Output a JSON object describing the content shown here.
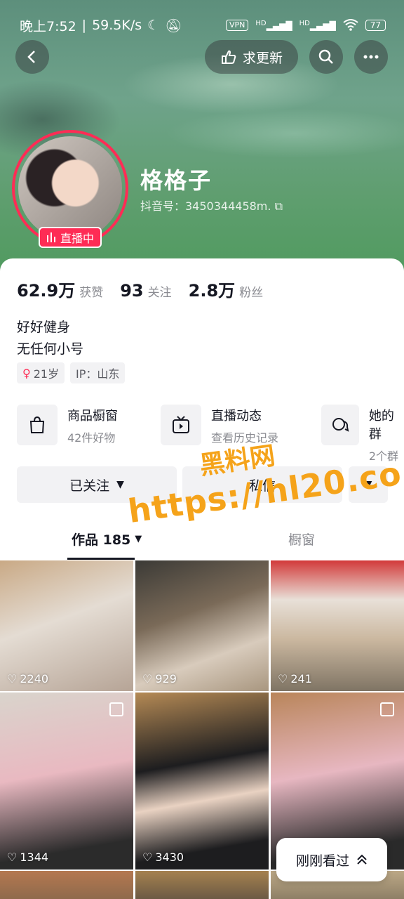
{
  "status_bar": {
    "time": "晚上7:52",
    "speed": "59.5K/s",
    "vpn": "VPN",
    "hd1": "HD",
    "hd2": "HD",
    "battery": "77"
  },
  "header": {
    "request_update": "求更新"
  },
  "profile": {
    "name": "格格子",
    "douyin_id": "抖音号：3450344458m.",
    "live_badge": "直播中"
  },
  "stats": [
    {
      "num": "62.9万",
      "label": "获赞"
    },
    {
      "num": "93",
      "label": "关注"
    },
    {
      "num": "2.8万",
      "label": "粉丝"
    }
  ],
  "bio": [
    "好好健身",
    "无任何小号"
  ],
  "tags": {
    "age": "21岁",
    "ip": "IP：山东"
  },
  "features": [
    {
      "title": "商品橱窗",
      "sub": "42件好物"
    },
    {
      "title": "直播动态",
      "sub": "查看历史记录"
    },
    {
      "title": "她的群",
      "sub": "2个群"
    }
  ],
  "actions": {
    "followed": "已关注",
    "message": "私信"
  },
  "tabs": {
    "works": "作品 185",
    "showcase": "橱窗"
  },
  "watermark": {
    "line1": "黑料网",
    "line2": "https://hl20.co"
  },
  "videos": [
    {
      "likes": "2240"
    },
    {
      "likes": "929"
    },
    {
      "likes": "241"
    },
    {
      "likes": "1344"
    },
    {
      "likes": "3430"
    },
    {
      "likes": ""
    }
  ],
  "recent": {
    "label": "刚刚看过"
  },
  "colors": {
    "accent": "#fe2c55",
    "watermark": "#f5a31a",
    "panel_bg": "#f2f2f4"
  }
}
